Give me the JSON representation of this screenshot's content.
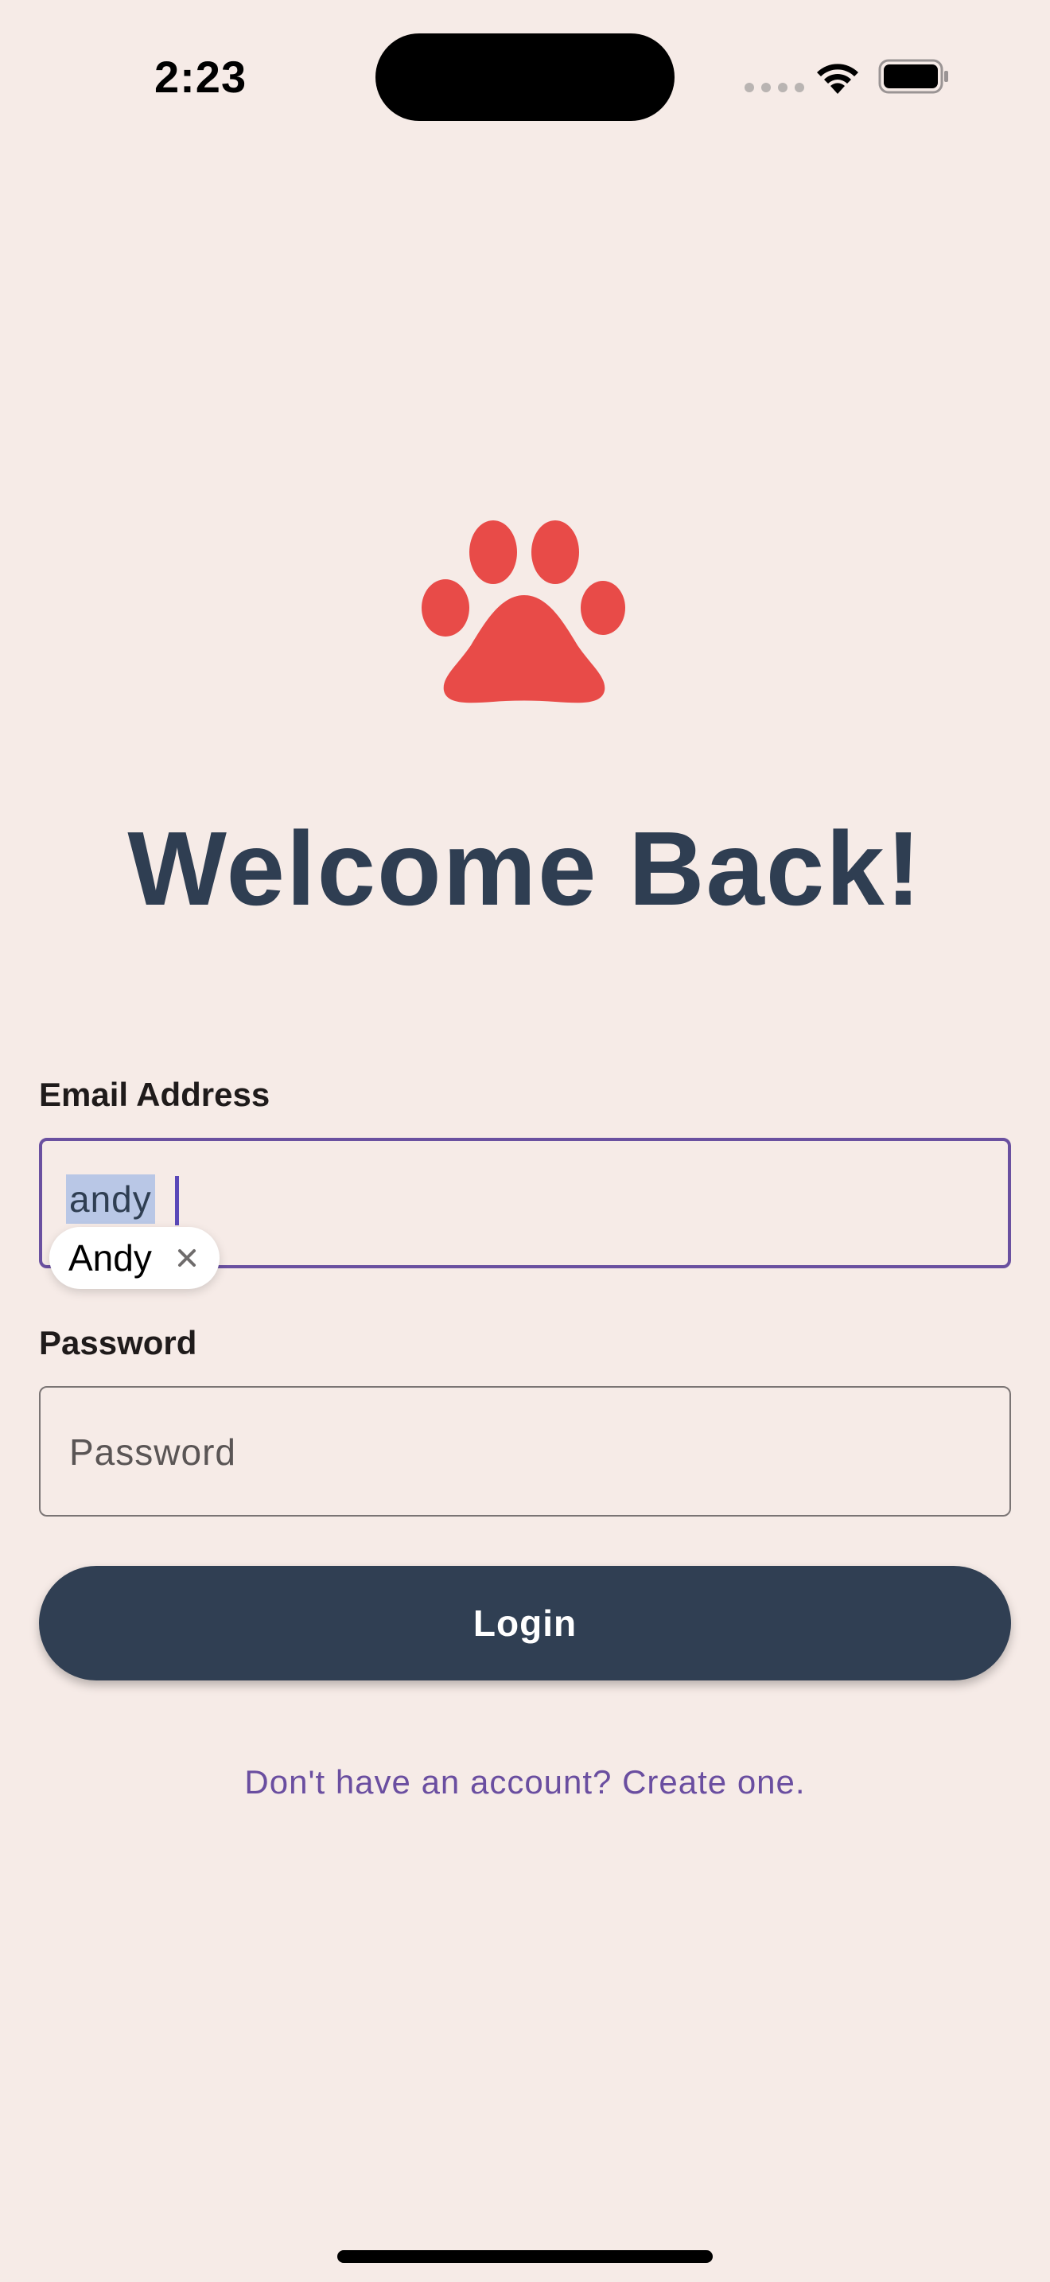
{
  "status_bar": {
    "time": "2:23"
  },
  "logo": {
    "icon": "paw-icon",
    "color": "#e84b48"
  },
  "title": "Welcome Back!",
  "form": {
    "email": {
      "label": "Email Address",
      "value": "andy",
      "autofill_suggestion": "Andy"
    },
    "password": {
      "label": "Password",
      "placeholder": "Password",
      "value": ""
    },
    "login_label": "Login",
    "signup_link": "Don't have an account? Create one."
  },
  "colors": {
    "background": "#f6ebe7",
    "title": "#2f3e52",
    "button": "#303f53",
    "accent": "#6a50a0",
    "link": "#6a4ea0"
  }
}
